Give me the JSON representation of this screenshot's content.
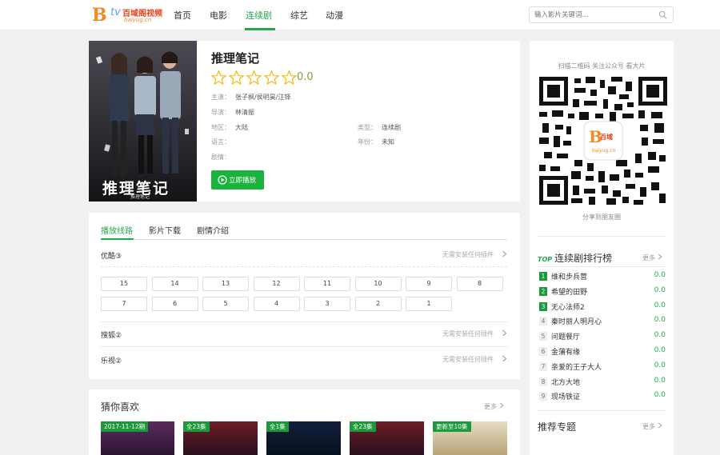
{
  "header": {
    "logo": {
      "mark": "B",
      "sub": "tv",
      "name_cn": "百域阁视频",
      "domain": "baiyug.cn"
    },
    "nav": [
      {
        "label": "首页",
        "active": false
      },
      {
        "label": "电影",
        "active": false
      },
      {
        "label": "连续剧",
        "active": true
      },
      {
        "label": "综艺",
        "active": false
      },
      {
        "label": "动漫",
        "active": false
      }
    ],
    "search": {
      "placeholder": "输入影片关键词...",
      "icon": "search-icon"
    }
  },
  "detail": {
    "title": "推理笔记",
    "poster_text": "推理笔记",
    "poster_sub": "推理笔记",
    "stars": 5,
    "rating": "0.0",
    "fields": {
      "cast_label": "主演：",
      "cast": "张子枫/侯明昊/汪铎",
      "director_label": "导演：",
      "director": "林清振",
      "region_label": "地区：",
      "region": "大陆",
      "type_label": "类型：",
      "type": "连续剧",
      "language_label": "语言：",
      "language": "",
      "year_label": "年份：",
      "year": "未知",
      "plot_label": "剧情：",
      "plot": ""
    },
    "play_label": "立即播放"
  },
  "playlist": {
    "tabs": [
      "播放线路",
      "影片下载",
      "剧情介绍"
    ],
    "active_tab": 0,
    "sources": [
      {
        "name": "优酷③",
        "hint": "无需安装任何插件"
      },
      {
        "name": "搜狐②",
        "hint": "无需安装任何插件"
      },
      {
        "name": "乐视②",
        "hint": "无需安装任何插件"
      }
    ],
    "episodes_row1": [
      "15",
      "14",
      "13",
      "12",
      "11",
      "10",
      "9",
      "8"
    ],
    "episodes_row2": [
      "7",
      "6",
      "5",
      "4",
      "3",
      "2",
      "1"
    ]
  },
  "recommend": {
    "title": "猜你喜欢",
    "more": "更多",
    "badges": [
      "2017-11-12期",
      "全23集",
      "全1集",
      "全23集",
      "更新至10集"
    ]
  },
  "sidebar": {
    "qr_caption": "扫描二维码 关注公众号 看大片",
    "share": "分享到朋友圈",
    "rank_top": "TOP",
    "rank_title": "连续剧排行榜",
    "more": "更多",
    "rank": [
      {
        "n": "1",
        "name": "维和步兵营",
        "score": "0.0"
      },
      {
        "n": "2",
        "name": "希望的田野",
        "score": "0.0"
      },
      {
        "n": "3",
        "name": "无心法师2",
        "score": "0.0"
      },
      {
        "n": "4",
        "name": "秦时丽人明月心",
        "score": "0.0"
      },
      {
        "n": "5",
        "name": "问题餐厅",
        "score": "0.0"
      },
      {
        "n": "6",
        "name": "金蒲有缘",
        "score": "0.0"
      },
      {
        "n": "7",
        "name": "亲爱的王子大人",
        "score": "0.0"
      },
      {
        "n": "8",
        "name": "北方大地",
        "score": "0.0"
      },
      {
        "n": "9",
        "name": "现场铁证",
        "score": "0.0"
      }
    ],
    "topics_title": "推荐专题",
    "topics_more": "更多"
  },
  "colors": {
    "accent": "#26a64b",
    "play_button": "#1ab33c",
    "star": "#f2b705"
  }
}
